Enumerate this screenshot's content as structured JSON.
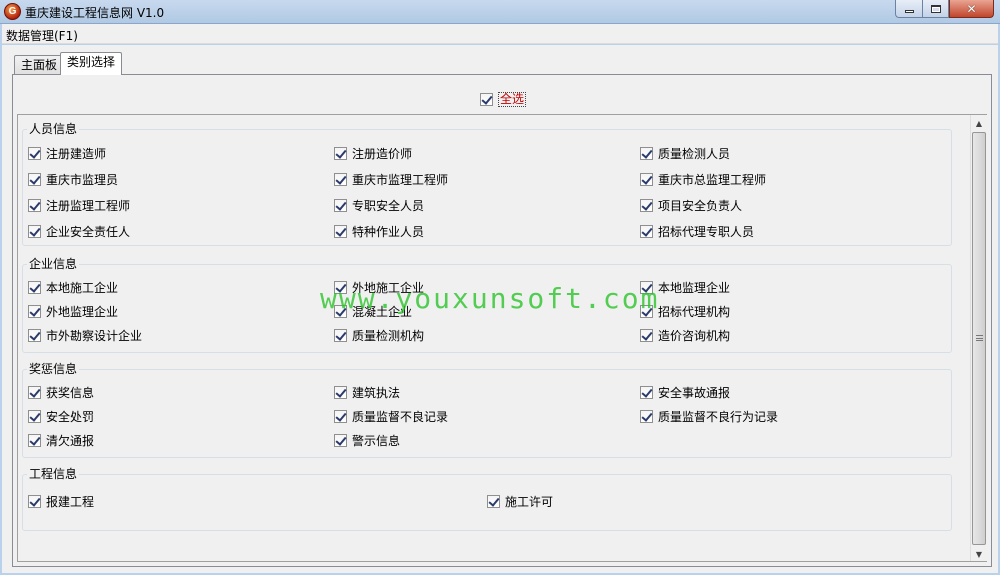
{
  "window": {
    "title": "重庆建设工程信息网 V1.0",
    "icon_letter": "G"
  },
  "menu": {
    "item": "数据管理(F1)"
  },
  "tabs": [
    {
      "label": "主面板"
    },
    {
      "label": "类别选择"
    }
  ],
  "select_all": {
    "label": "全选"
  },
  "groups": {
    "personnel": {
      "title": "人员信息",
      "items": [
        "注册建造师",
        "注册造价师",
        "质量检测人员",
        "重庆市监理员",
        "重庆市监理工程师",
        "重庆市总监理工程师",
        "注册监理工程师",
        "专职安全人员",
        "项目安全负责人",
        "企业安全责任人",
        "特种作业人员",
        "招标代理专职人员"
      ]
    },
    "enterprise": {
      "title": "企业信息",
      "items": [
        "本地施工企业",
        "外地施工企业",
        "本地监理企业",
        "外地监理企业",
        "混凝土企业",
        "招标代理机构",
        "市外勘察设计企业",
        "质量检测机构",
        "造价咨询机构"
      ]
    },
    "rewards": {
      "title": "奖惩信息",
      "items": [
        "获奖信息",
        "建筑执法",
        "安全事故通报",
        "安全处罚",
        "质量监督不良记录",
        "质量监督不良行为记录",
        "清欠通报",
        "警示信息"
      ]
    },
    "project": {
      "title": "工程信息",
      "items": [
        "报建工程",
        "施工许可"
      ]
    }
  },
  "watermark": "www.youxunsoft.com",
  "colors": {
    "titlebar": "#b9d1ea",
    "select_all_text": "#c00000",
    "watermark": "#27c427",
    "check": "#2a3b6c"
  }
}
